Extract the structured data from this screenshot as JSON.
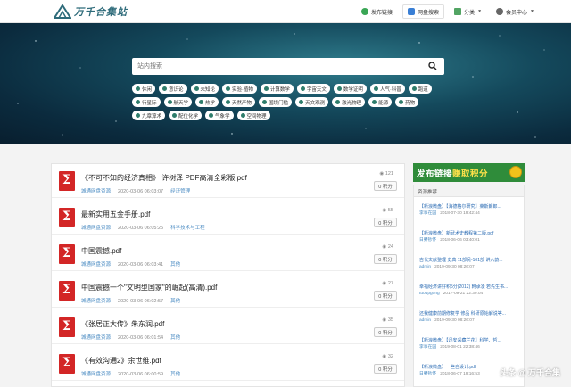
{
  "brand": {
    "name": "万千合集站"
  },
  "nav": {
    "publish": "发布链接",
    "cloud_search": "网盘搜索",
    "category": "分类",
    "member": "会员中心"
  },
  "search": {
    "placeholder": "站内搜索"
  },
  "tags": {
    "row1": [
      "休闲",
      "意识论",
      "未知论",
      "实验·植物",
      "计算数学",
      "宇宙天文",
      "数学证明",
      "人气·科普",
      "跑道"
    ],
    "row2": [
      "行星际",
      "航天学",
      "热学",
      "天然产物",
      "国境门槛",
      "天文观测",
      "激光物理",
      "能源",
      "药物"
    ],
    "row3": [
      "九章算术",
      "配位化学",
      "气象学",
      "空间物理"
    ]
  },
  "items": [
    {
      "title": "《不可不知的经济真相》 许树泽 PDF高清全彩版.pdf",
      "source": "城通网盘资源",
      "date": "2020-03-06 06:03:07",
      "category": "经济管理",
      "views": "121",
      "score": "0 积分"
    },
    {
      "title": "最新实用五金手册.pdf",
      "source": "城通网盘资源",
      "date": "2020-03-06 06:05:25",
      "category": "科学技术与工程",
      "views": "55",
      "score": "0 积分"
    },
    {
      "title": "中国震撼.pdf",
      "source": "城通网盘资源",
      "date": "2020-03-06 06:03:41",
      "category": "其他",
      "views": "24",
      "score": "0 积分"
    },
    {
      "title": "中国震撼一个\"文明型国家\"的崛起(高清).pdf",
      "source": "城通网盘资源",
      "date": "2020-03-06 06:02:57",
      "category": "其他",
      "views": "27",
      "score": "0 积分"
    },
    {
      "title": "《张居正大传》朱东润.pdf",
      "source": "城通网盘资源",
      "date": "2020-03-06 06:01:54",
      "category": "其他",
      "views": "35",
      "score": "0 积分"
    },
    {
      "title": "《有效沟通2》余世维.pdf",
      "source": "城通网盘资源",
      "date": "2020-03-06 06:00:59",
      "category": "其他",
      "views": "32",
      "score": "0 积分"
    }
  ],
  "sidebar": {
    "banner_a": "发布链接",
    "banner_b": "赚取积分",
    "panel_title": "资源推荐",
    "recs": [
      {
        "title": "【新浪微盘】【海德格尔研究】莱斯朗郎...",
        "user": "李事在园",
        "date": "2018-07-30 19:42:44"
      },
      {
        "title": "【新浪微盘】新武术史教程第二版.pdf",
        "user": "日野钞怀",
        "date": "2018-06-06 03:40:01"
      },
      {
        "title": "古代文献整理 史典 11部民-101部 讲六韵...",
        "user": "admin",
        "date": "2019-09-30 08:26:07"
      },
      {
        "title": "幸福经济讲好积5分(2012) 韩承凌 若先生书...",
        "user": "tuoupgong",
        "date": "2017-09-21 22:39:04"
      },
      {
        "title": "还我健康前期修复学 修品 科研原始解说等...",
        "user": "admin",
        "date": "2019-09-30 08:26:07"
      },
      {
        "title": "【新浪微盘】【迅安采藏兰花】科学、哲...",
        "user": "李事在园",
        "date": "2019-08-01 22:38:46"
      },
      {
        "title": "【新浪微盘】一些自设计.pdf",
        "user": "日野钞怀",
        "date": "2018-06-07 19:16:53"
      }
    ]
  },
  "watermark": "头条 @ 万千合集"
}
